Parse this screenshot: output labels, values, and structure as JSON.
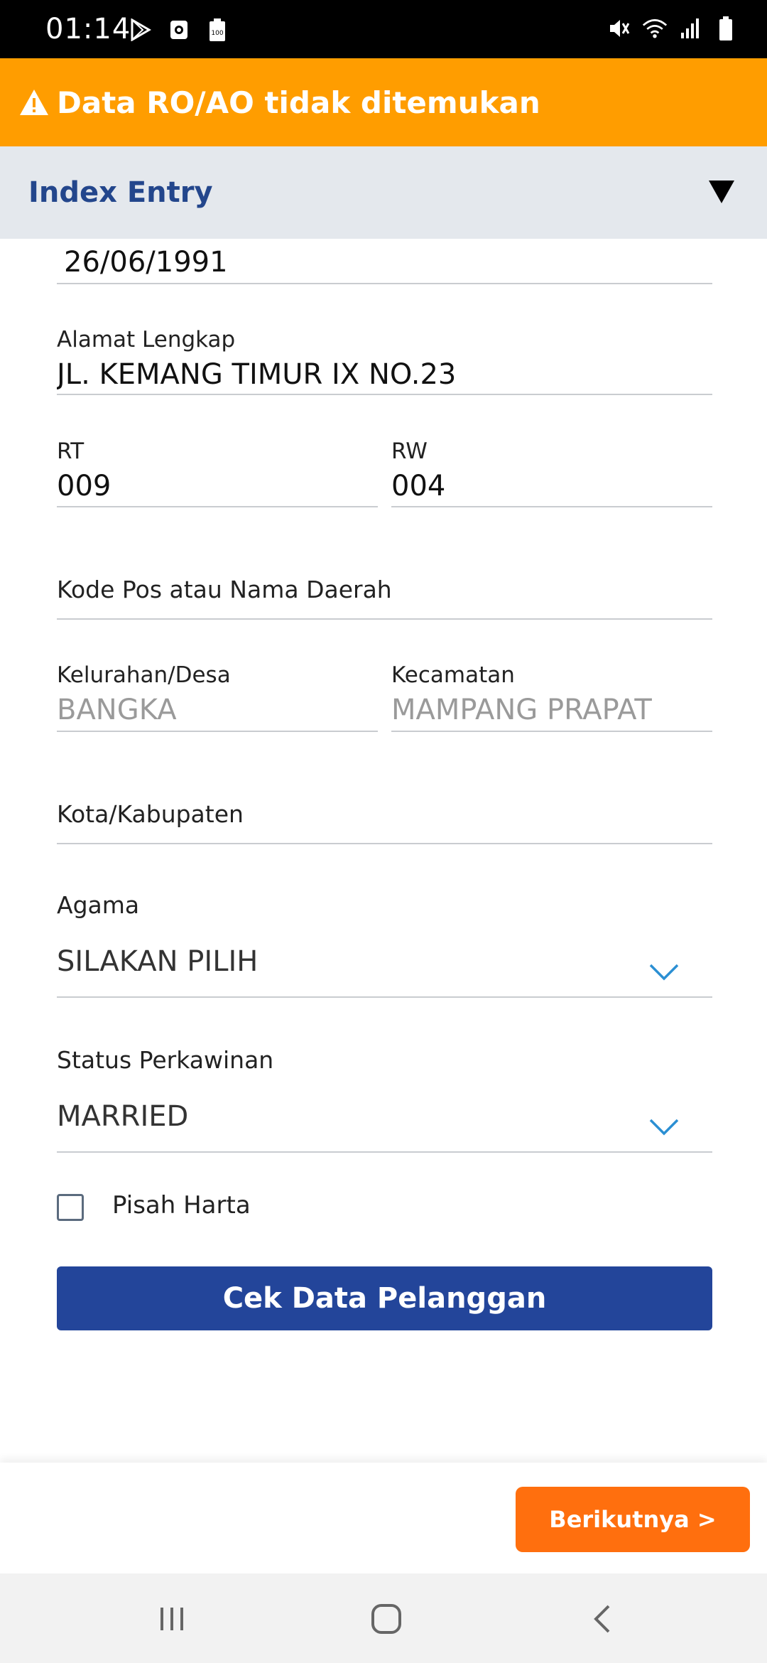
{
  "status_bar": {
    "time": "01:14",
    "left_icons": [
      "play-store-icon",
      "screen-record-icon",
      "battery-100-icon"
    ],
    "right_icons": [
      "mute-icon",
      "wifi-icon",
      "signal-icon",
      "battery-icon"
    ]
  },
  "banner": {
    "icon": "warning-icon",
    "text": "Data RO/AO tidak ditemukan",
    "color": "#FF9D00"
  },
  "section": {
    "title": "Index Entry",
    "toggle_icon": "triangle-down-icon"
  },
  "form": {
    "birth_date": {
      "value": "26/06/1991"
    },
    "address": {
      "label": "Alamat Lengkap",
      "value": "JL. KEMANG TIMUR IX NO.23"
    },
    "rt": {
      "label": "RT",
      "value": "009"
    },
    "rw": {
      "label": "RW",
      "value": "004"
    },
    "postal": {
      "label": "Kode Pos atau Nama Daerah"
    },
    "kelurahan": {
      "label": "Kelurahan/Desa",
      "value": "BANGKA"
    },
    "kecamatan": {
      "label": "Kecamatan",
      "value": "MAMPANG PRAPAT"
    },
    "kota": {
      "label": "Kota/Kabupaten"
    },
    "agama": {
      "label": "Agama",
      "value": "SILAKAN PILIH"
    },
    "status_perkawinan": {
      "label": "Status Perkawinan",
      "value": "MARRIED"
    },
    "pisah_harta": {
      "label": "Pisah Harta",
      "checked": false
    },
    "check_button": "Cek Data Pelanggan"
  },
  "footer": {
    "next_label": "Berikutnya >",
    "next_color": "#FF6F0E"
  },
  "nav": {
    "icons": [
      "recent-apps-icon",
      "home-icon",
      "back-icon"
    ]
  },
  "colors": {
    "primary": "#23459A",
    "title": "#23468C",
    "chevron": "#2B8FD3"
  }
}
